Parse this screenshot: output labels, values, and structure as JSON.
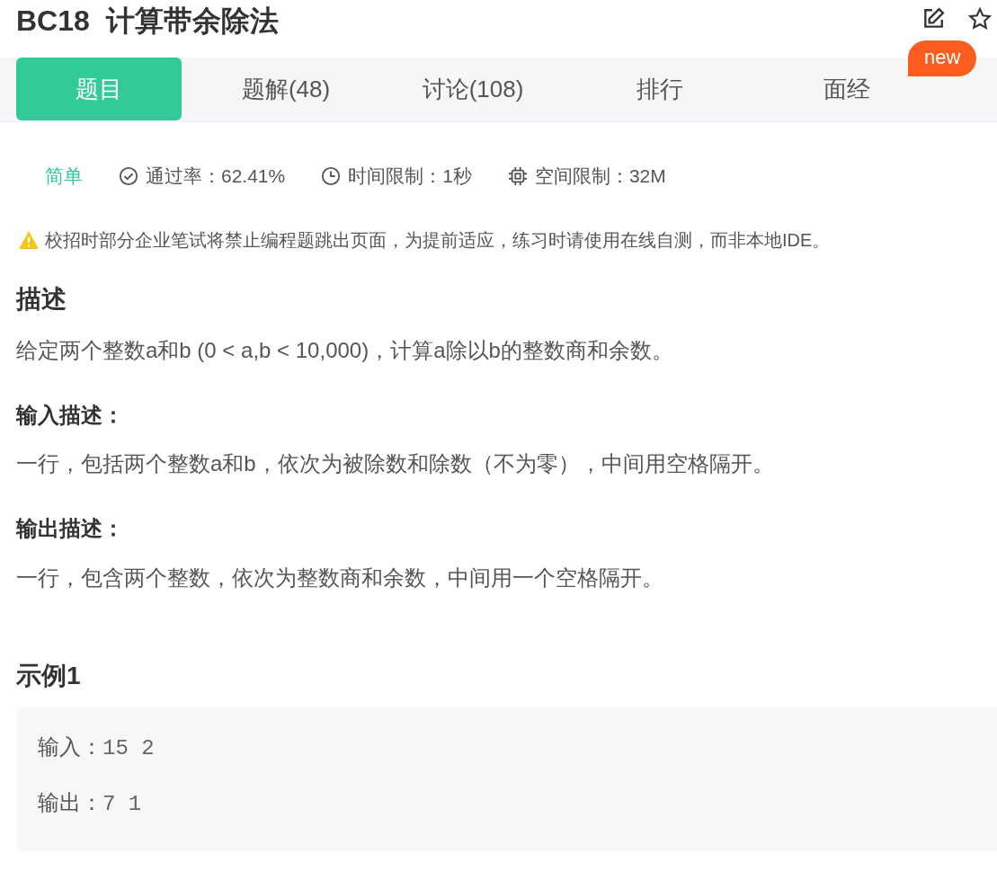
{
  "title": "BC18  计算带余除法",
  "tabs": [
    {
      "label": "题目",
      "selected": true
    },
    {
      "label": "题解(48)",
      "selected": false
    },
    {
      "label": "讨论(108)",
      "selected": false
    },
    {
      "label": "排行",
      "selected": false
    },
    {
      "label": "面经",
      "selected": false,
      "badge": "new"
    }
  ],
  "meta": [
    {
      "kind": "difficulty",
      "text": "简单"
    },
    {
      "kind": "pass_rate",
      "text": "通过率：62.41%"
    },
    {
      "kind": "time",
      "text": "时间限制：1秒"
    },
    {
      "kind": "memory",
      "text": "空间限制：32M"
    }
  ],
  "notice": "校招时部分企业笔试将禁止编程题跳出页面，为提前适应，练习时请使用在线自测，而非本地IDE。",
  "sections": [
    {
      "kind": "main",
      "heading": "描述",
      "text": "给定两个整数a和b (0 < a,b < 10,000)，计算a除以b的整数商和余数。"
    },
    {
      "kind": "sub",
      "heading": "输入描述：",
      "text": "一行，包括两个整数a和b，依次为被除数和除数（不为零），中间用空格隔开。"
    },
    {
      "kind": "sub",
      "heading": "输出描述：",
      "text": "一行，包含两个整数，依次为整数商和余数，中间用一个空格隔开。"
    }
  ],
  "example": {
    "title": "示例1",
    "rows": [
      {
        "label": "输入：",
        "value": "15 2"
      },
      {
        "label": "输出：",
        "value": "7 1"
      }
    ]
  }
}
